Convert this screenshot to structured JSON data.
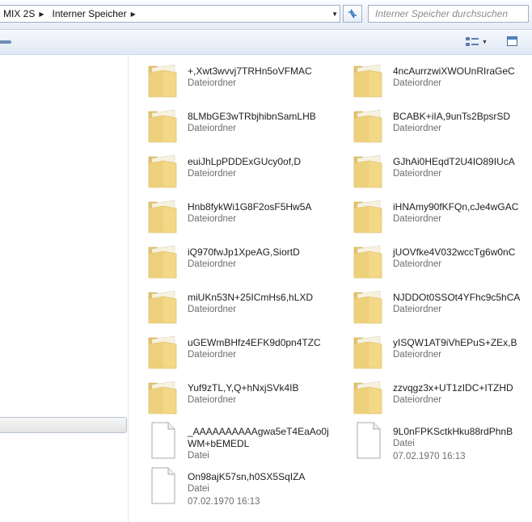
{
  "address": {
    "crumbs": [
      "MIX 2S",
      "Interner Speicher"
    ]
  },
  "search": {
    "placeholder": "Interner Speicher durchsuchen"
  },
  "folders": [
    {
      "name": "+,Xwt3wvvj7TRHn5oVFMAC",
      "type": "Dateiordner"
    },
    {
      "name": "4ncAurrzwiXWOUnRIraGeC",
      "type": "Dateiordner"
    },
    {
      "name": "8LMbGE3wTRbjhibnSamLHB",
      "type": "Dateiordner"
    },
    {
      "name": "BCABK+iIA,9unTs2BpsrSD",
      "type": "Dateiordner"
    },
    {
      "name": "euiJhLpPDDExGUcy0of,D",
      "type": "Dateiordner"
    },
    {
      "name": "GJhAi0HEqdT2U4IO89IUcA",
      "type": "Dateiordner"
    },
    {
      "name": "Hnb8fykWi1G8F2osF5Hw5A",
      "type": "Dateiordner"
    },
    {
      "name": "iHNAmy90fKFQn,cJe4wGAC",
      "type": "Dateiordner"
    },
    {
      "name": "iQ970fwJp1XpeAG,SiortD",
      "type": "Dateiordner"
    },
    {
      "name": "jUOVfke4V032wccTg6w0nC",
      "type": "Dateiordner"
    },
    {
      "name": "miUKn53N+25ICmHs6,hLXD",
      "type": "Dateiordner"
    },
    {
      "name": "NJDDOt0SSOt4YFhc9c5hCA",
      "type": "Dateiordner"
    },
    {
      "name": "uGEWmBHfz4EFK9d0pn4TZC",
      "type": "Dateiordner"
    },
    {
      "name": "yISQW1AT9iVhEPuS+ZEx,B",
      "type": "Dateiordner"
    },
    {
      "name": "Yuf9zTL,Y,Q+hNxjSVk4IB",
      "type": "Dateiordner"
    },
    {
      "name": "zzvqgz3x+UT1zIDC+ITZHD",
      "type": "Dateiordner"
    }
  ],
  "files": [
    {
      "name": "_AAAAAAAAAAgwa5eT4EaAo0jWM+bEMEDL",
      "type": "Datei",
      "date": ""
    },
    {
      "name": "9L0nFPKSctkHku88rdPhnB",
      "type": "Datei",
      "date": "07.02.1970 16:13"
    },
    {
      "name": "On98ajK57sn,h0SX5SqIZA",
      "type": "Datei",
      "date": "07.02.1970 16:13"
    }
  ]
}
